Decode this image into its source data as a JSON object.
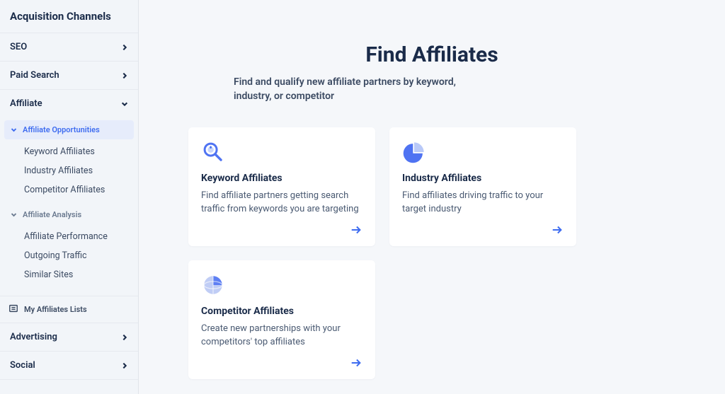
{
  "sidebar": {
    "title": "Acquisition Channels",
    "nav": [
      {
        "label": "SEO"
      },
      {
        "label": "Paid Search"
      },
      {
        "label": "Affiliate"
      },
      {
        "label": "Advertising"
      },
      {
        "label": "Social"
      }
    ],
    "affiliate": {
      "groups": [
        {
          "label": "Affiliate Opportunities",
          "active": true,
          "items": [
            {
              "label": "Keyword Affiliates"
            },
            {
              "label": "Industry Affiliates"
            },
            {
              "label": "Competitor Affiliates"
            }
          ]
        },
        {
          "label": "Affiliate Analysis",
          "active": false,
          "items": [
            {
              "label": "Affiliate Performance"
            },
            {
              "label": "Outgoing Traffic"
            },
            {
              "label": "Similar Sites"
            }
          ]
        }
      ],
      "my_lists_label": "My Affiliates Lists"
    }
  },
  "main": {
    "title": "Find Affiliates",
    "subtitle": "Find and qualify new affiliate partners by keyword, industry, or competitor",
    "cards": [
      {
        "title": "Keyword Affiliates",
        "desc": "Find affiliate partners getting search traffic from keywords you are targeting",
        "icon": "magnifier"
      },
      {
        "title": "Industry Affiliates",
        "desc": "Find affiliates driving traffic to your target industry",
        "icon": "pie"
      },
      {
        "title": "Competitor Affiliates",
        "desc": "Create new partnerships with your competitors' top affiliates",
        "icon": "globe"
      }
    ]
  }
}
